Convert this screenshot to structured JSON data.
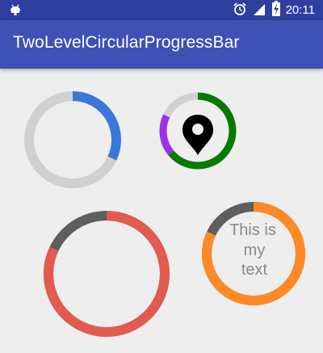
{
  "status_bar": {
    "time": "20:11",
    "icons": [
      "android-debug-icon",
      "alarm-icon",
      "cell-signal-icon",
      "battery-charging-icon"
    ]
  },
  "app_bar": {
    "title": "TwoLevelCircularProgressBar"
  },
  "progress_bars": [
    {
      "name": "blue-ring",
      "track_color": "#D0D0D0",
      "segments": [
        {
          "color": "#3A78D8",
          "fraction": 0.32
        }
      ]
    },
    {
      "name": "pin-ring",
      "track_color": "#D0D0D0",
      "segments": [
        {
          "color": "#087A00",
          "fraction": 0.64
        },
        {
          "color": "#9B32E8",
          "fraction": 0.18
        }
      ],
      "center_icon": "location-pin-icon"
    },
    {
      "name": "red-ring",
      "track_color": "#5E5E5E",
      "segments": [
        {
          "color": "#E35A4F",
          "fraction": 0.82
        }
      ]
    },
    {
      "name": "orange-ring",
      "track_color": "#5E5E5E",
      "segments": [
        {
          "color": "#FF8A25",
          "fraction": 0.82
        }
      ],
      "center_text": [
        "This is",
        "my",
        "text"
      ]
    }
  ]
}
